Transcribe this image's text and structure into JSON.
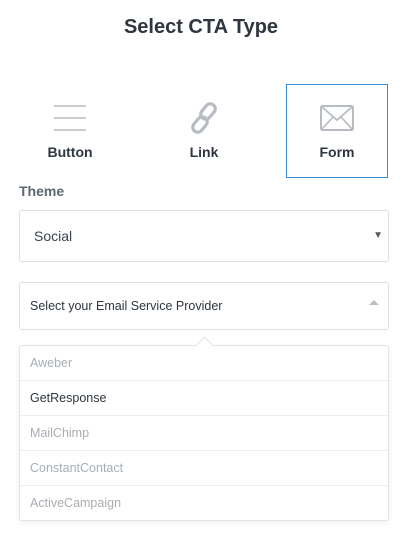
{
  "header": {
    "title": "Select CTA Type"
  },
  "cta_types": [
    {
      "label": "Button",
      "icon": "button-lines-icon",
      "selected": false
    },
    {
      "label": "Link",
      "icon": "link-chain-icon",
      "selected": false
    },
    {
      "label": "Form",
      "icon": "envelope-icon",
      "selected": true
    }
  ],
  "theme": {
    "label": "Theme",
    "value": "Social"
  },
  "esp": {
    "placeholder": "Select your Email Service Provider",
    "options": [
      {
        "label": "Aweber",
        "enabled": false
      },
      {
        "label": "GetResponse",
        "enabled": true
      },
      {
        "label": "MailChimp",
        "enabled": false
      },
      {
        "label": "ConstantContact",
        "enabled": false
      },
      {
        "label": "ActiveCampaign",
        "enabled": false
      }
    ]
  },
  "colors": {
    "selected_border": "#3a8ecf",
    "icon_gray": "#b7bcc2",
    "text_dark": "#2f3640",
    "text_disabled": "#a9aeb4"
  }
}
